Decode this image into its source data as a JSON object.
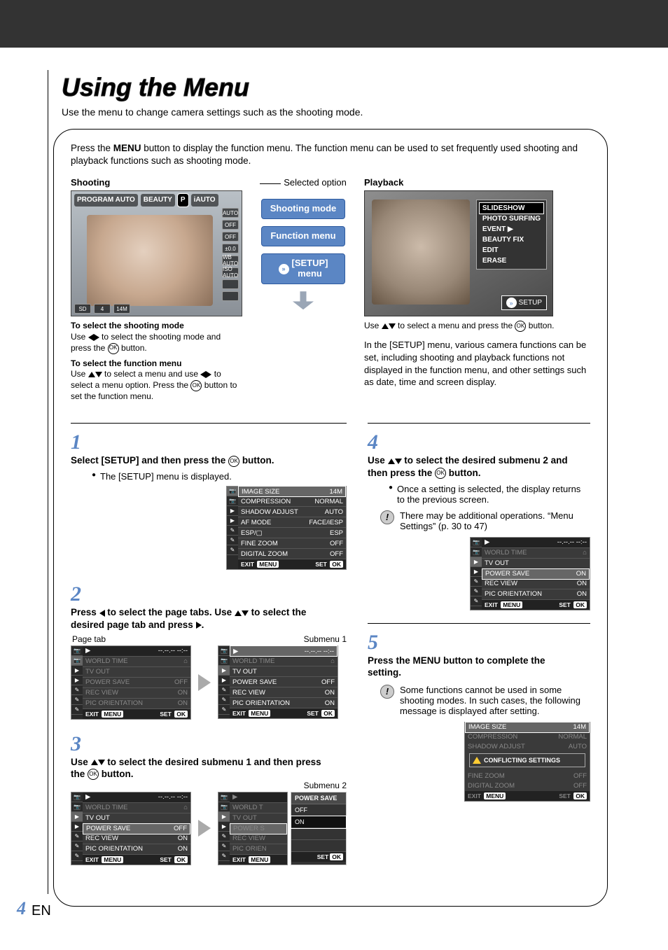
{
  "page": {
    "number": "4",
    "lang": "EN"
  },
  "title": "Using the Menu",
  "intro": "Use the menu to change camera settings such as the shooting mode.",
  "top_desc": {
    "pre": "Press the ",
    "btn": "MENU",
    "post": " button to display the function menu. The function menu can be used to set frequently used shooting and playback functions such as shooting mode."
  },
  "labels": {
    "shooting": "Shooting",
    "playback": "Playback",
    "selected_option": "Selected option",
    "shooting_mode": "Shooting mode",
    "function_menu": "Function menu",
    "setup_menu1": "[SETUP]",
    "setup_menu2": "menu",
    "page_tab": "Page tab",
    "submenu1": "Submenu 1",
    "submenu2": "Submenu 2"
  },
  "shooting_panel": {
    "modes": [
      "PROGRAM AUTO",
      "BEAUTY",
      "P",
      "iAUTO"
    ],
    "right_icons": [
      "AUTO",
      "OFF",
      "OFF",
      "±0.0",
      "WB AUTO",
      "ISO AUTO"
    ],
    "bottom": [
      "4",
      "14M"
    ]
  },
  "playback_panel": {
    "items": [
      "SLIDESHOW",
      "PHOTO SURFING",
      "EVENT ▶",
      "BEAUTY FIX",
      "EDIT",
      "ERASE"
    ],
    "setup": "SETUP"
  },
  "help": {
    "sel_shoot_title": "To select the shooting mode",
    "sel_shoot_body1": "Use ",
    "sel_shoot_body2": " to select the shooting mode and press the ",
    "sel_shoot_body3": " button.",
    "sel_fn_title": "To select the function menu",
    "sel_fn_body1": "Use ",
    "sel_fn_body2": " to select a menu and use ",
    "sel_fn_body3": " to select a menu option. Press the ",
    "sel_fn_body4": " button to set the function menu.",
    "pb_body1": "Use ",
    "pb_body2": " to select a menu and press the ",
    "pb_body3": " button."
  },
  "setup_para": "In the [SETUP] menu, various camera functions can be set, including shooting and playback functions not displayed in the function menu, and other settings such as date, time and screen display.",
  "steps": {
    "s1": {
      "n": "1",
      "t": "Select [SETUP] and then press the ",
      "t2": " button.",
      "b": "The [SETUP] menu is displayed."
    },
    "s2": {
      "n": "2",
      "t": "Press ",
      "t2": " to select the page tabs. Use ",
      "t3": " to select the desired page tab and press ",
      "t4": "."
    },
    "s3": {
      "n": "3",
      "t": "Use ",
      "t2": " to select the desired submenu 1 and then press the ",
      "t3": " button."
    },
    "s4": {
      "n": "4",
      "t": "Use ",
      "t2": " to select the desired submenu 2 and then press the ",
      "t3": " button.",
      "b": "Once a setting is selected, the display returns to the previous screen.",
      "note": "There may be additional operations. “Menu Settings” (p. 30 to 47)"
    },
    "s5": {
      "n": "5",
      "t1": "Press the ",
      "btn": "MENU",
      "t2": " button to complete the setting.",
      "note": "Some functions cannot be used in some shooting modes. In such cases, the following message is displayed after setting."
    }
  },
  "menu1": {
    "rows": [
      [
        "IMAGE SIZE",
        "14M"
      ],
      [
        "COMPRESSION",
        "NORMAL"
      ],
      [
        "SHADOW ADJUST",
        "AUTO"
      ],
      [
        "AF MODE",
        "FACE/iESP"
      ],
      [
        "ESP/▢",
        "ESP"
      ],
      [
        "FINE ZOOM",
        "OFF"
      ],
      [
        "DIGITAL ZOOM",
        "OFF"
      ]
    ],
    "exit": "EXIT",
    "menu": "MENU",
    "set": "SET",
    "ok": "OK"
  },
  "menu2": {
    "head": "--.--.-- --:--",
    "rows": [
      [
        "WORLD TIME",
        "⌂"
      ],
      [
        "TV OUT",
        ""
      ],
      [
        "POWER SAVE",
        "OFF"
      ],
      [
        "REC VIEW",
        "ON"
      ],
      [
        "PIC ORIENTATION",
        "ON"
      ]
    ],
    "rows_on": [
      [
        "WORLD TIME",
        "⌂"
      ],
      [
        "TV OUT",
        ""
      ],
      [
        "POWER SAVE",
        "ON"
      ],
      [
        "REC VIEW",
        "ON"
      ],
      [
        "PIC ORIENTATION",
        "ON"
      ]
    ],
    "exit": "EXIT",
    "menu": "MENU",
    "set": "SET",
    "ok": "OK"
  },
  "popup": {
    "header": "POWER SAVE",
    "opts": [
      "OFF",
      "ON"
    ]
  },
  "conflict": {
    "rows": [
      [
        "IMAGE SIZE",
        "14M"
      ],
      [
        "COMPRESSION",
        "NORMAL"
      ],
      [
        "SHADOW ADJUST",
        "AUTO"
      ],
      [
        "",
        ""
      ],
      [
        "",
        ""
      ],
      [
        "FINE ZOOM",
        "OFF"
      ],
      [
        "DIGITAL ZOOM",
        "OFF"
      ]
    ],
    "msg": "CONFLICTING SETTINGS",
    "exit": "EXIT",
    "menu": "MENU",
    "set": "SET",
    "ok": "OK"
  }
}
